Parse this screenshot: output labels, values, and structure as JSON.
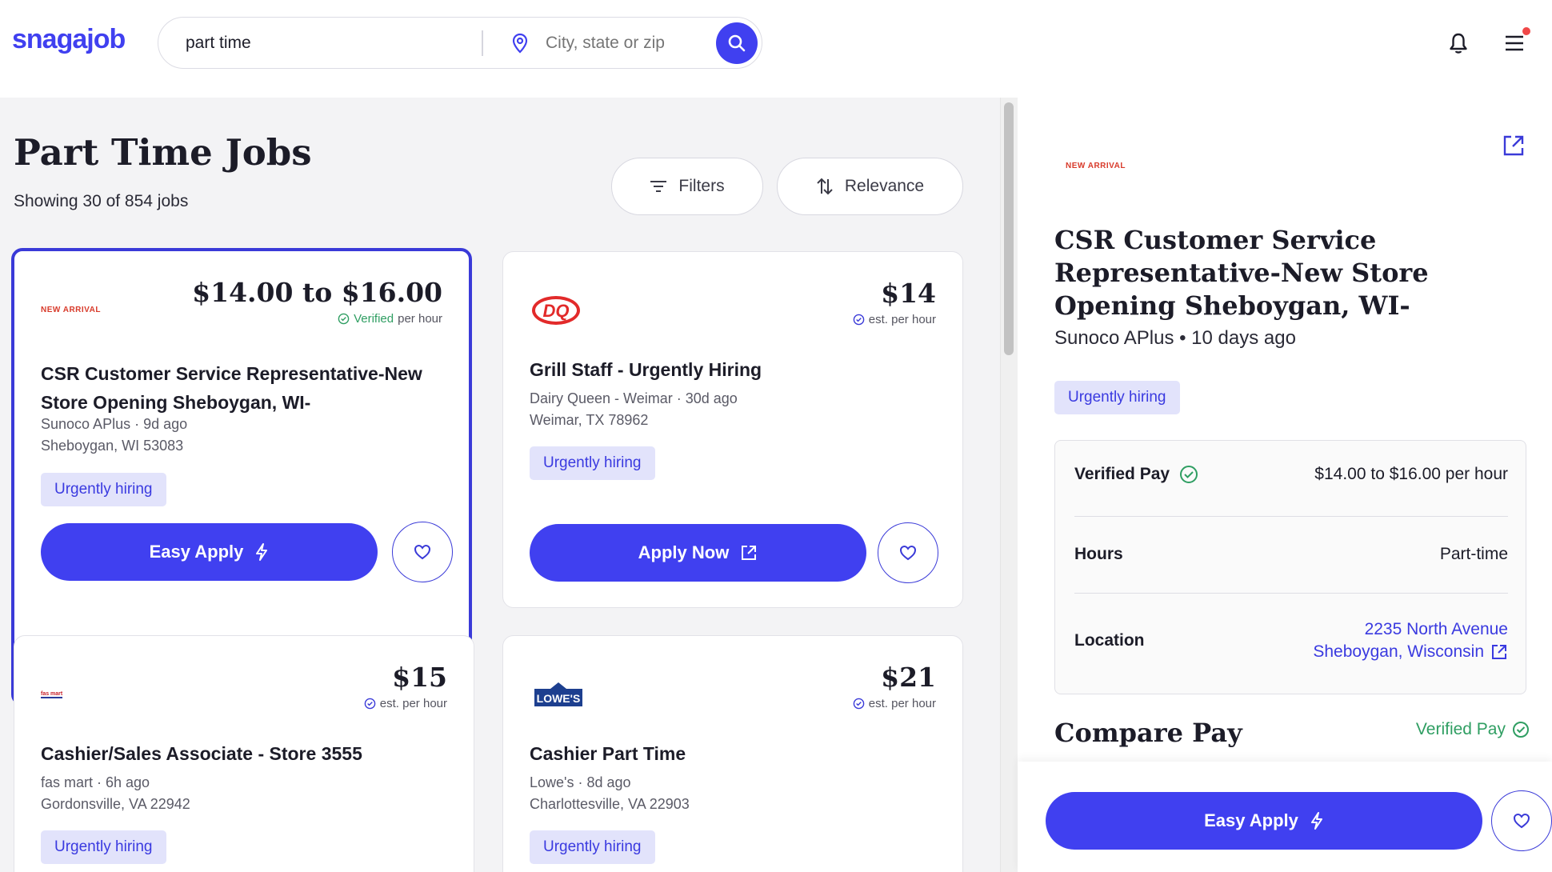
{
  "header": {
    "logo": "snagajob",
    "search_query": "part time",
    "location_placeholder": "City, state or zip"
  },
  "listing": {
    "title": "Part Time Jobs",
    "count": "Showing 30 of 854 jobs",
    "filters_label": "Filters",
    "sort_label": "Relevance"
  },
  "jobs": [
    {
      "logo_text": "NEW ARRIVAL",
      "pay": "$14.00 to $16.00",
      "pay_verified": "Verified",
      "pay_unit": "per hour",
      "title": "CSR Customer Service Representative-New Store Opening Sheboygan, WI-",
      "company": "Sunoco APlus · 9d ago",
      "location": "Sheboygan, WI 53083",
      "tag": "Urgently hiring",
      "apply": "Easy Apply"
    },
    {
      "logo_text": "DQ",
      "pay": "$14",
      "pay_unit": "est. per hour",
      "title": "Grill Staff - Urgently Hiring",
      "company": "Dairy Queen - Weimar · 30d ago",
      "location": "Weimar, TX 78962",
      "tag": "Urgently hiring",
      "apply": "Apply Now"
    },
    {
      "logo_text": "fas mart",
      "pay": "$15",
      "pay_unit": "est. per hour",
      "title": "Cashier/Sales Associate - Store 3555",
      "company": "fas mart · 6h ago",
      "location": "Gordonsville, VA 22942",
      "tag": "Urgently hiring"
    },
    {
      "logo_text": "LOWE'S",
      "pay": "$21",
      "pay_unit": "est. per hour",
      "title": "Cashier Part Time",
      "company": "Lowe's · 8d ago",
      "location": "Charlottesville, VA 22903",
      "tag": "Urgently hiring"
    }
  ],
  "detail": {
    "logo_text": "NEW ARRIVAL",
    "title": "CSR Customer Service Representative-New Store Opening Sheboygan, WI-",
    "company": "Sunoco APlus • 10 days ago",
    "tag": "Urgently hiring",
    "verified_pay_label": "Verified Pay",
    "verified_pay_value": "$14.00 to $16.00 per hour",
    "hours_label": "Hours",
    "hours_value": "Part-time",
    "location_label": "Location",
    "location_line1": "2235 North Avenue",
    "location_line2": "Sheboygan, Wisconsin",
    "compare_title": "Compare Pay",
    "compare_verified": "Verified Pay",
    "apply": "Easy Apply"
  },
  "colors": {
    "brand": "#4040f0",
    "tag_bg": "#e2e3fb",
    "verified": "#2f9e62"
  }
}
